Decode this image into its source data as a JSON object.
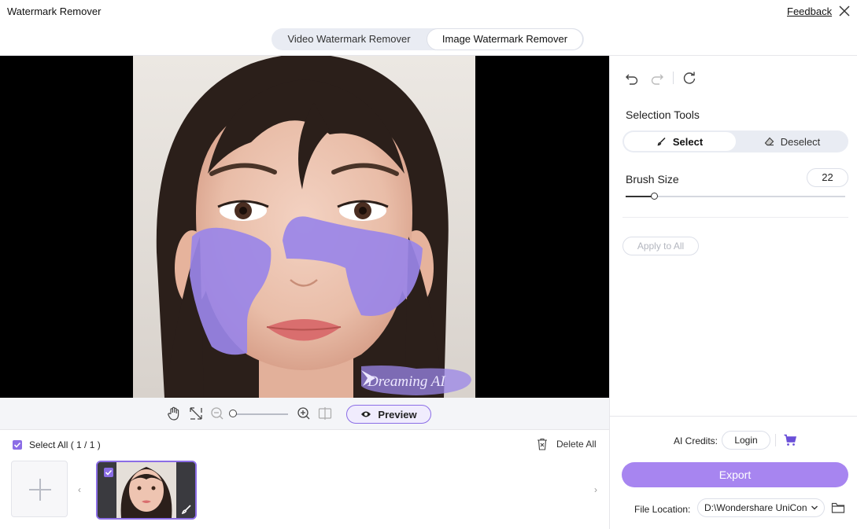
{
  "window": {
    "title": "Watermark Remover",
    "feedback_label": "Feedback"
  },
  "mode_tabs": [
    {
      "label": "Video Watermark Remover",
      "active": false
    },
    {
      "label": "Image Watermark Remover",
      "active": true
    }
  ],
  "canvas": {
    "watermark_text": "Dreaming AI",
    "mask_color": "#9a86e8"
  },
  "zoombar": {
    "icons": [
      "hand-icon",
      "fit-screen-icon",
      "zoom-out-icon",
      "zoom-in-icon",
      "compare-icon"
    ],
    "preview_label": "Preview"
  },
  "file_strip": {
    "select_all_label": "Select All ( 1 / 1 )",
    "delete_all_label": "Delete All"
  },
  "right_panel": {
    "history_icons": [
      "undo-icon",
      "redo-icon",
      "reset-icon"
    ],
    "selection_tools_title": "Selection Tools",
    "select_label": "Select",
    "deselect_label": "Deselect",
    "brush_size_label": "Brush Size",
    "brush_size_value": "22",
    "apply_to_all_label": "Apply to All",
    "credits_label": "AI Credits:",
    "login_label": "Login",
    "export_label": "Export",
    "file_location_label": "File Location:",
    "file_location_value": "D:\\Wondershare UniCon"
  },
  "colors": {
    "accent": "#8b6de6",
    "export": "#a785f0",
    "cart": "#6a4fd8"
  }
}
